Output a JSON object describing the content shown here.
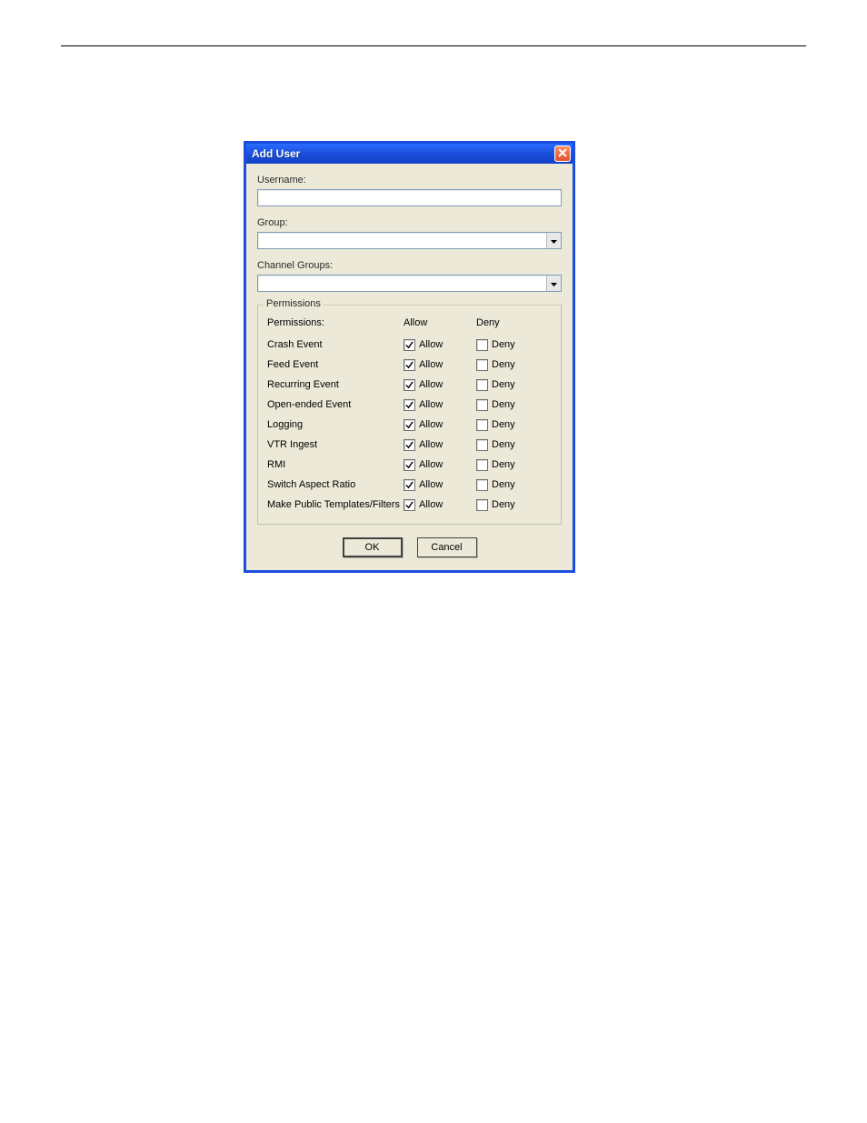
{
  "dialog": {
    "title": "Add User",
    "fields": {
      "username_label": "Username:",
      "username_value": "",
      "group_label": "Group:",
      "group_value": "",
      "channel_groups_label": "Channel Groups:",
      "channel_groups_value": ""
    },
    "permissions": {
      "legend": "Permissions",
      "header": {
        "name": "Permissions:",
        "allow": "Allow",
        "deny": "Deny"
      },
      "allow_word": "Allow",
      "deny_word": "Deny",
      "rows": [
        {
          "name": "Crash Event",
          "allow": true,
          "deny": false
        },
        {
          "name": "Feed Event",
          "allow": true,
          "deny": false
        },
        {
          "name": "Recurring Event",
          "allow": true,
          "deny": false
        },
        {
          "name": "Open-ended Event",
          "allow": true,
          "deny": false
        },
        {
          "name": "Logging",
          "allow": true,
          "deny": false
        },
        {
          "name": "VTR Ingest",
          "allow": true,
          "deny": false
        },
        {
          "name": "RMI",
          "allow": true,
          "deny": false
        },
        {
          "name": "Switch Aspect Ratio",
          "allow": true,
          "deny": false
        },
        {
          "name": "Make Public Templates/Filters",
          "allow": true,
          "deny": false
        }
      ]
    },
    "buttons": {
      "ok": "OK",
      "cancel": "Cancel"
    }
  }
}
